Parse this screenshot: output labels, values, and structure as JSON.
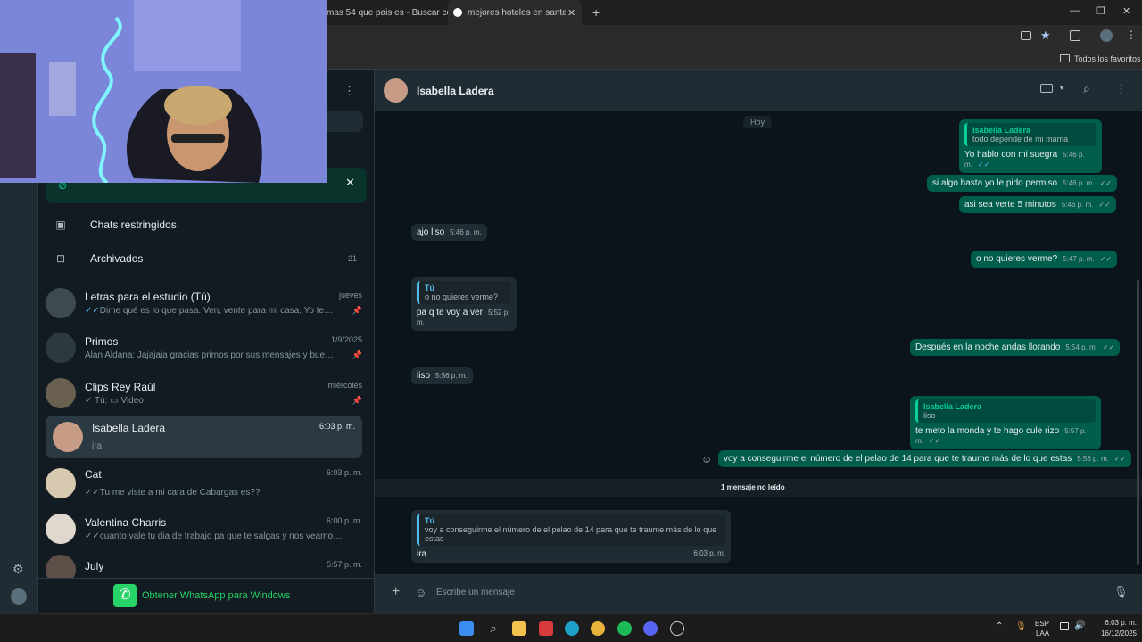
{
  "browser": {
    "tabs": [
      {
        "label": "mas 54 que pais es - Buscar co"
      },
      {
        "label": "mejores hoteles en santa marta"
      }
    ],
    "bookmarks_label": "Todos los favoritos"
  },
  "sidebar": {
    "restricted_label": "Chats restringidos",
    "archived_label": "Archivados",
    "archived_count": "21",
    "chats": [
      {
        "name": "Letras para el estudio (Tú)",
        "time": "jueves",
        "preview": "Dime qué es lo que pasa. Ven, vente para mi casa. Yo te esper...",
        "pinned": true,
        "read": true
      },
      {
        "name": "Primos",
        "time": "1/9/2025",
        "preview": "Alan Aldana: Jajajaja gracias primos por sus mensajes y buenos ...",
        "pinned": true
      },
      {
        "name": "Clips Rey Raúl",
        "time": "miércoles",
        "preview_prefix": "Tú:",
        "preview": "Video",
        "pinned": true
      },
      {
        "name": "Isabella  Ladera",
        "time": "6:03 p. m.",
        "preview": "ira",
        "selected": true
      },
      {
        "name": "Cat",
        "time": "6:03 p. m.",
        "preview": "Tu me viste a mi cara de Cabargas es??",
        "read": true
      },
      {
        "name": "Valentina Charris",
        "time": "6:00 p. m.",
        "preview": "cuanto vale tu dia de trabajo pa que te salgas y nos veamos ahori...",
        "read": true
      },
      {
        "name": "July",
        "time": "5:57 p. m."
      }
    ],
    "promo_label": "Obtener WhatsApp para Windows"
  },
  "chat": {
    "contact_name": "Isabella  Ladera",
    "day_label": "Hoy",
    "unread_label": "1 mensaje no leído",
    "composer_placeholder": "Escribe un mensaje",
    "messages": [
      {
        "dir": "out",
        "quote_name": "Isabella Ladera",
        "quote_text": "todo depende de mi mama",
        "text": "Yo hablo con mi suegra",
        "time": "5:46 p. m."
      },
      {
        "dir": "out",
        "text": "si algo hasta yo le pido permiso",
        "time": "5:46 p. m."
      },
      {
        "dir": "out",
        "text": "asi sea verte 5 minutos",
        "time": "5:46 p. m."
      },
      {
        "dir": "in",
        "text": "ajo liso",
        "time": "5:46 p. m."
      },
      {
        "dir": "out",
        "text": "o no quieres verme?",
        "time": "5:47 p. m."
      },
      {
        "dir": "in",
        "quote_name": "Tú",
        "quote_text": "o no quieres verme?",
        "text": "pa q te voy a ver",
        "time": "5:52 p. m."
      },
      {
        "dir": "out",
        "text": "Después en la noche andas llorando",
        "time": "5:54 p. m."
      },
      {
        "dir": "in",
        "text": "liso",
        "time": "5:56 p. m."
      },
      {
        "dir": "out",
        "quote_name": "Isabella Ladera",
        "quote_text": "liso",
        "text": "te meto la monda y te hago cule rizo",
        "time": "5:57 p. m."
      },
      {
        "dir": "out",
        "text": "voy a conseguirme el número de el pelao de 14 para que te traume más de lo que estas",
        "time": "5:58 p. m."
      },
      {
        "dir": "in",
        "quote_name": "Tú",
        "quote_text": "voy a conseguirme el número de el pelao de 14 para que te traume más de lo que estas",
        "text": "ira",
        "time": "6:03 p. m."
      }
    ]
  },
  "taskbar": {
    "lang": "ESP",
    "lang_sub": "LAA",
    "time": "6:03 p. m.",
    "date": "16/12/2025"
  },
  "colors": {
    "outgoing_bubble": "#005c4b",
    "incoming_bubble": "#202c33",
    "accent": "#06cf9c",
    "promo_button": "#25d366"
  }
}
